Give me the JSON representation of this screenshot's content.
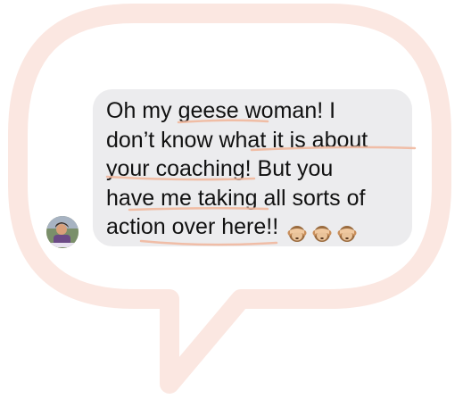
{
  "message": {
    "lines": [
      "Oh my geese woman! I",
      "don’t know what it is about",
      "your coaching! But you",
      "have me taking all sorts of",
      "action over here!!"
    ],
    "emoji_icons": [
      "see-no-evil-monkey-icon",
      "see-no-evil-monkey-icon",
      "see-no-evil-monkey-icon"
    ]
  },
  "colors": {
    "bubble_background": "#ececee",
    "outline_stroke": "#fbe7e1",
    "underline_stroke": "#f1b89e",
    "text": "#111111"
  }
}
